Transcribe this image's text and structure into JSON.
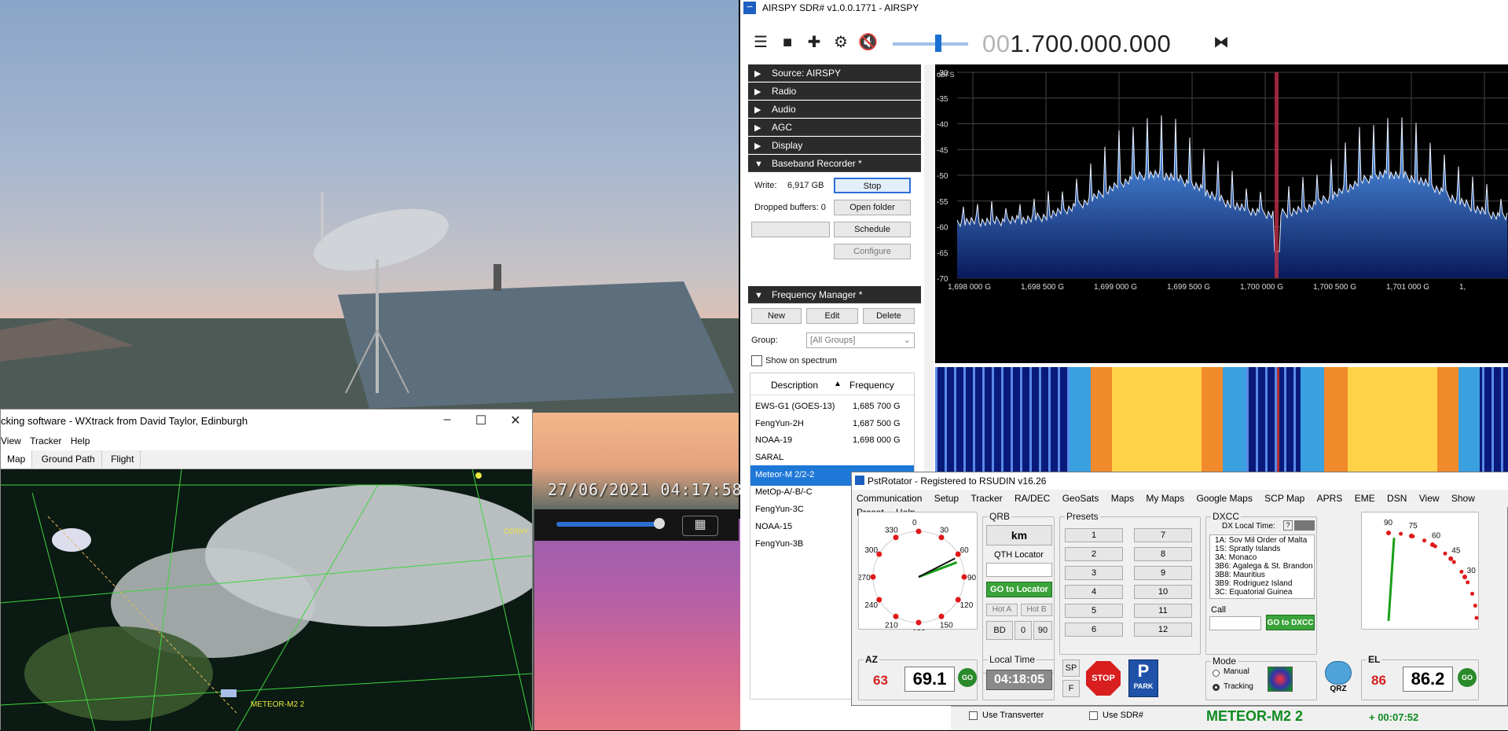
{
  "camera": {
    "timestamp": "27/06/2021 04:17:58"
  },
  "wxtrack": {
    "title": "cking software - WXtrack from David Taylor, Edinburgh",
    "menu": [
      "View",
      "Tracker",
      "Help"
    ],
    "tabs": [
      "Map",
      "Ground Path",
      "Flight"
    ],
    "window_buttons": [
      "–",
      "☐",
      "✕"
    ],
    "map_satellite_label": "METEOR-M2 2",
    "map_label_right": "CERNY"
  },
  "sdr": {
    "title": "AIRSPY SDR# v1.0.0.1771 - AIRSPY",
    "frequency_dim": "00",
    "frequency_main": "1.700.000.000",
    "sections_collapsed": [
      "Source: AIRSPY",
      "Radio",
      "Audio",
      "AGC",
      "Display"
    ],
    "baseband": {
      "header": "Baseband Recorder *",
      "write_label": "Write:",
      "write_value": "6,917 GB",
      "stop": "Stop",
      "dropped_label": "Dropped buffers: 0",
      "open_folder": "Open folder",
      "schedule": "Schedule",
      "configure": "Configure"
    },
    "freq_manager": {
      "header": "Frequency Manager *",
      "new": "New",
      "edit": "Edit",
      "delete": "Delete",
      "group_label": "Group:",
      "group_value": "[All Groups]",
      "show_on_spectrum": "Show on spectrum",
      "col_description": "Description",
      "col_frequency": "Frequency",
      "rows": [
        {
          "name": "EWS-G1 (GOES-13)",
          "freq": "1,685 700 G"
        },
        {
          "name": "FengYun-2H",
          "freq": "1,687 500 G"
        },
        {
          "name": "NOAA-19",
          "freq": "1,698 000 G"
        },
        {
          "name": "SARAL",
          "freq": ""
        },
        {
          "name": "Meteor-M 2/2-2",
          "freq": ""
        },
        {
          "name": "MetOp-A/-B/-C",
          "freq": ""
        },
        {
          "name": "FengYun-3C",
          "freq": ""
        },
        {
          "name": "NOAA-15",
          "freq": ""
        },
        {
          "name": "FengYun-3B",
          "freq": ""
        }
      ]
    },
    "spectrum": {
      "unit": "dBFS",
      "y_ticks": [
        "-30",
        "-35",
        "-40",
        "-45",
        "-50",
        "-55",
        "-60",
        "-65",
        "-70"
      ],
      "x_ticks": [
        "1,698 000 G",
        "1,698 500 G",
        "1,699 000 G",
        "1,699 500 G",
        "1,700 000 G",
        "1,700 500 G",
        "1,701 000 G",
        "1,"
      ]
    },
    "bottom": {
      "use_transverter": "Use Transverter",
      "use_sdr": "Use SDR#",
      "satellite": "METEOR-M2 2",
      "countdown": "+ 00:07:52"
    }
  },
  "pstrotator": {
    "title": "PstRotator - Registered to RSUDIN  v16.26",
    "menu": [
      "Communication",
      "Setup",
      "Tracker",
      "RA/DEC",
      "GeoSats",
      "Maps",
      "My Maps",
      "Google Maps",
      "SCP Map",
      "APRS",
      "EME",
      "DSN",
      "View",
      "Show",
      "Preset",
      "Help"
    ],
    "compass_labels": [
      "0",
      "30",
      "60",
      "90",
      "120",
      "150",
      "180",
      "210",
      "240",
      "270",
      "300",
      "330"
    ],
    "qrb": {
      "label": "QRB",
      "unit": "km",
      "qth_label": "QTH Locator",
      "go_locator": "GO to Locator",
      "hot_a": "Hot A",
      "hot_b": "Hot B",
      "bd": "BD",
      "bd0": "0",
      "bd90": "90"
    },
    "presets": {
      "label": "Presets",
      "left": [
        "1",
        "2",
        "3",
        "4",
        "5",
        "6"
      ],
      "right": [
        "7",
        "8",
        "9",
        "10",
        "11",
        "12"
      ]
    },
    "dxcc": {
      "label": "DXCC",
      "local_time_label": "DX Local Time:",
      "help": "?",
      "entries": [
        "1A:  Sov Mil Order of Malta",
        "1S:  Spratly Islands",
        "3A:  Monaco",
        "3B6:  Agalega & St. Brandon",
        "3B8:  Mauritius",
        "3B9:  Rodriguez Island",
        "3C:  Equatorial Guinea"
      ],
      "call_label": "Call",
      "go_dxcc": "GO to DXCC"
    },
    "elevation_labels": [
      "90",
      "75",
      "60",
      "45",
      "30"
    ],
    "az": {
      "label": "AZ",
      "target": "63",
      "current": "69.1",
      "go": "GO"
    },
    "local_time": {
      "label": "Local Time",
      "value": "04:18:05"
    },
    "sp": "SP",
    "f": "F",
    "stop": "STOP",
    "park": "PARK",
    "mode": {
      "label": "Mode",
      "manual": "Manual",
      "tracking": "Tracking"
    },
    "qrz": "QRZ",
    "el": {
      "label": "EL",
      "target": "86",
      "current": "86.2",
      "go": "GO"
    },
    "compass_az_deg": 69.1
  },
  "colors": {
    "spectrum_fill": "#1f6cc8",
    "waterfall_hot": "#ffd24a",
    "go_green": "#3aa33a",
    "red_value": "#d42020"
  }
}
